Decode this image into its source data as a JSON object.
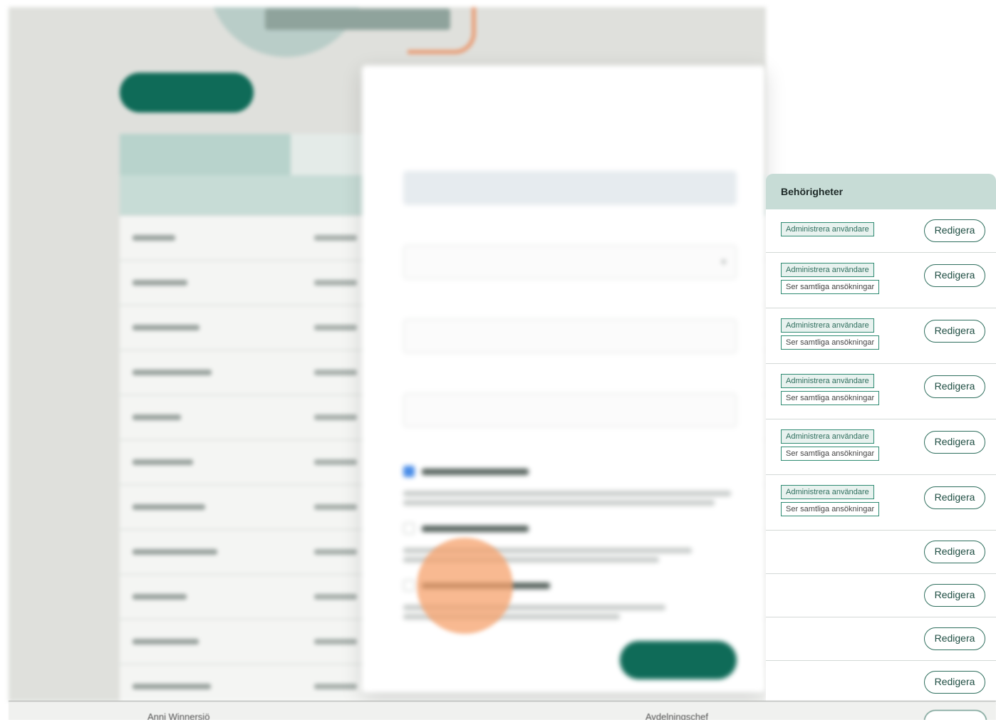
{
  "background": {
    "add_button_label": "",
    "tabs": [
      ""
    ],
    "table_header": [
      "",
      ""
    ],
    "rows": 11
  },
  "modal": {
    "title": "",
    "subtitle": "",
    "close_label": "",
    "fields": [
      {
        "label": "",
        "value": ""
      },
      {
        "label": "",
        "value": ""
      },
      {
        "label": "",
        "value": ""
      },
      {
        "label": "",
        "value": ""
      }
    ],
    "section_label": "",
    "submit_label": ""
  },
  "permissions_panel": {
    "header": "Behörigheter",
    "rows": [
      {
        "tags": [
          "Administrera användare"
        ],
        "edit_label": "Redigera"
      },
      {
        "tags": [
          "Administrera användare",
          "Ser samtliga ansökningar"
        ],
        "edit_label": "Redigera"
      },
      {
        "tags": [
          "Administrera användare",
          "Ser samtliga ansökningar"
        ],
        "edit_label": "Redigera"
      },
      {
        "tags": [
          "Administrera användare",
          "Ser samtliga ansökningar"
        ],
        "edit_label": "Redigera"
      },
      {
        "tags": [
          "Administrera användare",
          "Ser samtliga ansökningar"
        ],
        "edit_label": "Redigera"
      },
      {
        "tags": [
          "Administrera användare",
          "Ser samtliga ansökningar"
        ],
        "edit_label": "Redigera"
      },
      {
        "tags": [],
        "edit_label": "Redigera"
      },
      {
        "tags": [],
        "edit_label": "Redigera"
      },
      {
        "tags": [],
        "edit_label": "Redigera"
      },
      {
        "tags": [],
        "edit_label": "Redigera"
      }
    ]
  },
  "footer_row": {
    "name": "Anni Winnersjö",
    "title": "Avdelningschef"
  }
}
